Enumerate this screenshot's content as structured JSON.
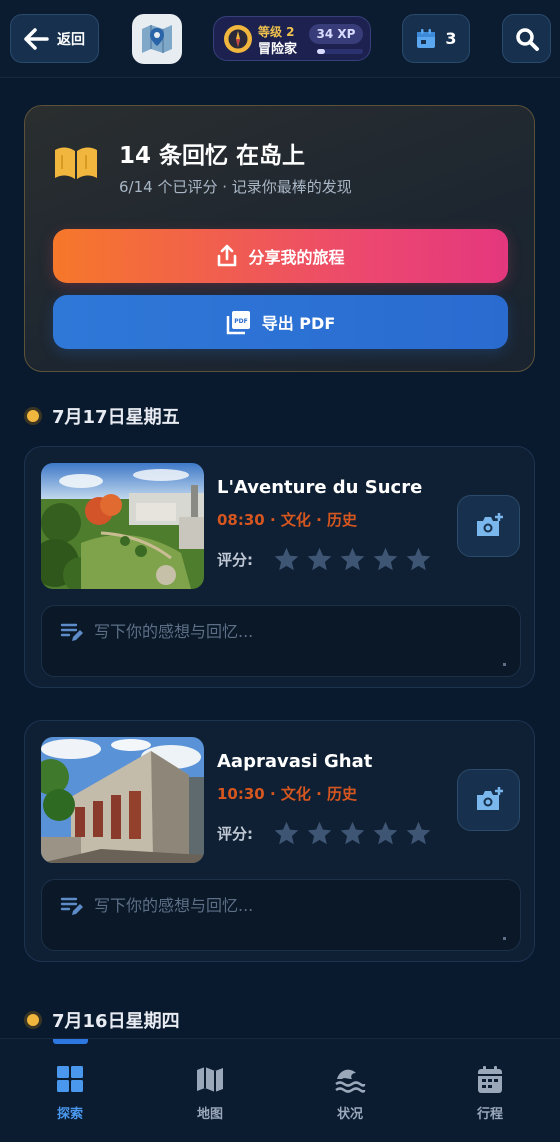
{
  "header": {
    "back_label": "返回",
    "level_label": "等级 2",
    "rank_label": "冒险家",
    "xp_label": "34 XP",
    "xp_progress": 0.17,
    "calendar_count": "3"
  },
  "summary": {
    "title": "14 条回忆 在岛上",
    "subtitle": "6/14 个已评分 · 记录你最棒的发现",
    "share_label": "分享我的旅程",
    "pdf_label": "导出 PDF",
    "pdf_icon_text": "PDF"
  },
  "days": [
    {
      "date": "7月17日星期五",
      "entries": [
        {
          "name": "L'Aventure du Sucre",
          "meta": "08:30 · 文化 · 历史",
          "rating_label": "评分:",
          "rating": 0,
          "note_placeholder": "写下你的感想与回忆..."
        },
        {
          "name": "Aapravasi Ghat",
          "meta": "10:30 · 文化 · 历史",
          "rating_label": "评分:",
          "rating": 0,
          "note_placeholder": "写下你的感想与回忆..."
        }
      ]
    },
    {
      "date": "7月16日星期四",
      "entries": []
    }
  ],
  "nav": {
    "items": [
      {
        "label": "探索",
        "icon": "grid-icon",
        "active": true
      },
      {
        "label": "地图",
        "icon": "map-icon",
        "active": false
      },
      {
        "label": "状况",
        "icon": "waves-icon",
        "active": false
      },
      {
        "label": "行程",
        "icon": "calendar-icon",
        "active": false
      }
    ]
  },
  "colors": {
    "accent_orange": "#d6561f",
    "accent_gold": "#f0b63d",
    "nav_active": "#4a98ee",
    "nav_inactive": "#9aa8ba"
  }
}
